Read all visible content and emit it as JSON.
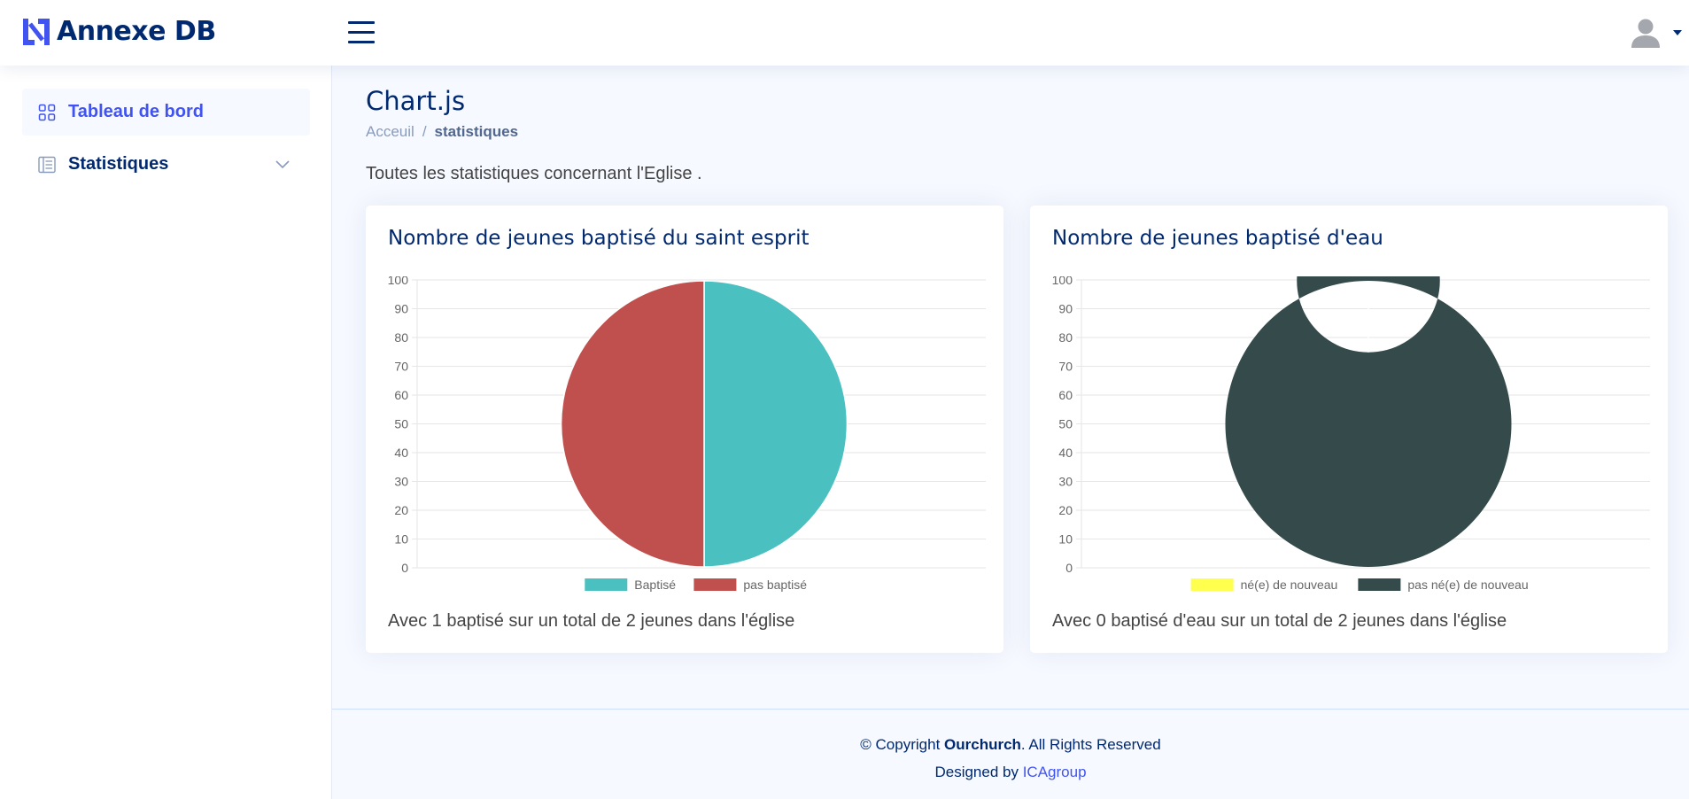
{
  "app": {
    "name": "Annexe DB"
  },
  "sidebar": {
    "items": [
      {
        "label": "Tableau de bord",
        "icon": "grid-icon",
        "active": true
      },
      {
        "label": "Statistiques",
        "icon": "layout-text-icon",
        "expandable": true
      }
    ]
  },
  "page": {
    "title": "Chart.js",
    "breadcrumb": {
      "home": "Acceuil",
      "separator": "/",
      "current": "statistiques"
    },
    "intro": "Toutes les statistiques concernant l'Eglise ."
  },
  "cards": [
    {
      "title": "Nombre de jeunes baptisé du saint esprit",
      "footer": "Avec 1 baptisé sur un total de 2 jeunes dans l'église"
    },
    {
      "title": "Nombre de jeunes baptisé d'eau",
      "footer": "Avec 0 baptisé d'eau sur un total de 2 jeunes dans l'église"
    }
  ],
  "footer": {
    "copyright_prefix": "© Copyright ",
    "brand": "Ourchurch",
    "copyright_suffix": ". All Rights Reserved",
    "designed_prefix": "Designed by ",
    "designer": "ICAgroup"
  },
  "colors": {
    "accent": "#4154f1",
    "navy": "#012970"
  },
  "chart_data": [
    {
      "type": "pie",
      "categories": [
        "Baptisé",
        "pas baptisé"
      ],
      "values": [
        1,
        1
      ],
      "colors": [
        "#4bc0c0",
        "#c0504d"
      ],
      "ylim": [
        0,
        100
      ],
      "ticks": [
        0,
        10,
        20,
        30,
        40,
        50,
        60,
        70,
        80,
        90,
        100
      ],
      "grid": true,
      "legend": "bottom"
    },
    {
      "type": "doughnut",
      "categories": [
        "né(e) de nouveau",
        "pas né(e) de nouveau"
      ],
      "values": [
        0,
        2
      ],
      "colors": [
        "#ffff4d",
        "#354a4a"
      ],
      "ylim": [
        0,
        100
      ],
      "ticks": [
        0,
        10,
        20,
        30,
        40,
        50,
        60,
        70,
        80,
        90,
        100
      ],
      "grid": true,
      "legend": "bottom"
    }
  ]
}
